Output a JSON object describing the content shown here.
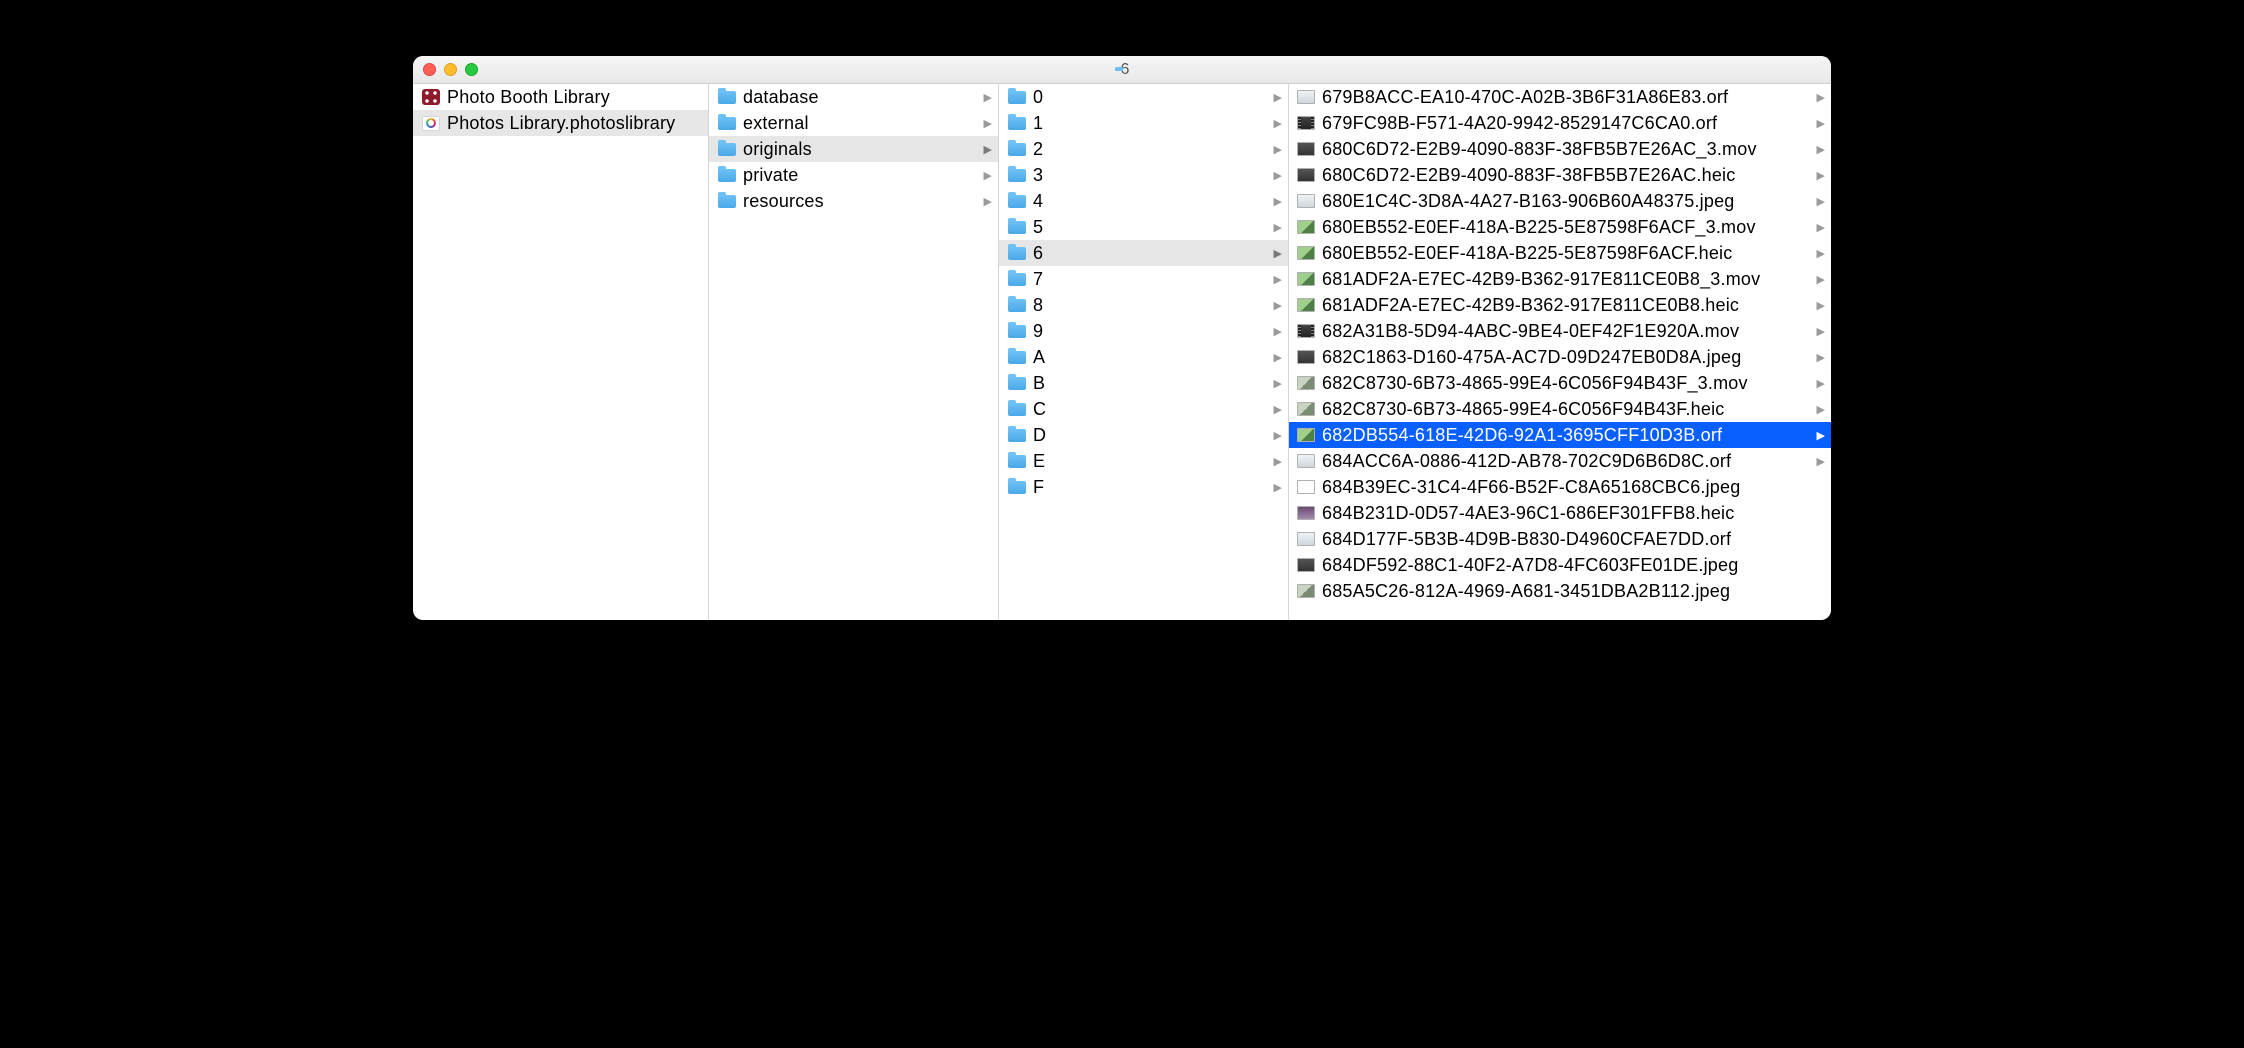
{
  "window": {
    "title": "6"
  },
  "col0": [
    {
      "label": "Photo Booth Library",
      "iconType": "pb",
      "selected": false,
      "hasChildren": false
    },
    {
      "label": "Photos Library.photoslibrary",
      "iconType": "photos",
      "selected": true,
      "hasChildren": false
    }
  ],
  "col1": [
    {
      "label": "database",
      "iconType": "folder",
      "selected": false,
      "hasChildren": true
    },
    {
      "label": "external",
      "iconType": "folder",
      "selected": false,
      "hasChildren": true
    },
    {
      "label": "originals",
      "iconType": "folder",
      "selected": true,
      "hasChildren": true
    },
    {
      "label": "private",
      "iconType": "folder",
      "selected": false,
      "hasChildren": true
    },
    {
      "label": "resources",
      "iconType": "folder",
      "selected": false,
      "hasChildren": true
    }
  ],
  "col2": [
    {
      "label": "0",
      "iconType": "folder",
      "selected": false,
      "hasChildren": true
    },
    {
      "label": "1",
      "iconType": "folder",
      "selected": false,
      "hasChildren": true
    },
    {
      "label": "2",
      "iconType": "folder",
      "selected": false,
      "hasChildren": true
    },
    {
      "label": "3",
      "iconType": "folder",
      "selected": false,
      "hasChildren": true
    },
    {
      "label": "4",
      "iconType": "folder",
      "selected": false,
      "hasChildren": true
    },
    {
      "label": "5",
      "iconType": "folder",
      "selected": false,
      "hasChildren": true
    },
    {
      "label": "6",
      "iconType": "folder",
      "selected": true,
      "hasChildren": true
    },
    {
      "label": "7",
      "iconType": "folder",
      "selected": false,
      "hasChildren": true
    },
    {
      "label": "8",
      "iconType": "folder",
      "selected": false,
      "hasChildren": true
    },
    {
      "label": "9",
      "iconType": "folder",
      "selected": false,
      "hasChildren": true
    },
    {
      "label": "A",
      "iconType": "folder",
      "selected": false,
      "hasChildren": true
    },
    {
      "label": "B",
      "iconType": "folder",
      "selected": false,
      "hasChildren": true
    },
    {
      "label": "C",
      "iconType": "folder",
      "selected": false,
      "hasChildren": true
    },
    {
      "label": "D",
      "iconType": "folder",
      "selected": false,
      "hasChildren": true
    },
    {
      "label": "E",
      "iconType": "folder",
      "selected": false,
      "hasChildren": true
    },
    {
      "label": "F",
      "iconType": "folder",
      "selected": false,
      "hasChildren": true
    }
  ],
  "col3": [
    {
      "label": "679B8ACC-EA10-470C-A02B-3B6F31A86E83.orf",
      "iconType": "thumb snow",
      "arrow": true
    },
    {
      "label": "679FC98B-F571-4A20-9942-8529147C6CA0.orf",
      "iconType": "thumb mov",
      "arrow": true
    },
    {
      "label": "680C6D72-E2B9-4090-883F-38FB5B7E26AC_3.mov",
      "iconType": "thumb dark",
      "arrow": true
    },
    {
      "label": "680C6D72-E2B9-4090-883F-38FB5B7E26AC.heic",
      "iconType": "thumb dark",
      "arrow": true
    },
    {
      "label": "680E1C4C-3D8A-4A27-B163-906B60A48375.jpeg",
      "iconType": "thumb snow",
      "arrow": true
    },
    {
      "label": "680EB552-E0EF-418A-B225-5E87598F6ACF_3.mov",
      "iconType": "thumb green",
      "arrow": true
    },
    {
      "label": "680EB552-E0EF-418A-B225-5E87598F6ACF.heic",
      "iconType": "thumb green",
      "arrow": true
    },
    {
      "label": "681ADF2A-E7EC-42B9-B362-917E811CE0B8_3.mov",
      "iconType": "thumb green",
      "arrow": true
    },
    {
      "label": "681ADF2A-E7EC-42B9-B362-917E811CE0B8.heic",
      "iconType": "thumb green",
      "arrow": true
    },
    {
      "label": "682A31B8-5D94-4ABC-9BE4-0EF42F1E920A.mov",
      "iconType": "thumb mov",
      "arrow": true
    },
    {
      "label": "682C1863-D160-475A-AC7D-09D247EB0D8A.jpeg",
      "iconType": "thumb dark",
      "arrow": true
    },
    {
      "label": "682C8730-6B73-4865-99E4-6C056F94B43F_3.mov",
      "iconType": "thumb",
      "arrow": true
    },
    {
      "label": "682C8730-6B73-4865-99E4-6C056F94B43F.heic",
      "iconType": "thumb",
      "arrow": true
    },
    {
      "label": "682DB554-618E-42D6-92A1-3695CFF10D3B.orf",
      "iconType": "thumb green",
      "arrow": true,
      "selected": true
    },
    {
      "label": "684ACC6A-0886-412D-AB78-702C9D6B6D8C.orf",
      "iconType": "thumb snow",
      "arrow": true
    },
    {
      "label": "684B39EC-31C4-4F66-B52F-C8A65168CBC6.jpeg",
      "iconType": "thumb white",
      "arrow": false
    },
    {
      "label": "684B231D-0D57-4AE3-96C1-686EF301FFB8.heic",
      "iconType": "thumb purple",
      "arrow": false
    },
    {
      "label": "684D177F-5B3B-4D9B-B830-D4960CFAE7DD.orf",
      "iconType": "thumb snow",
      "arrow": false
    },
    {
      "label": "684DF592-88C1-40F2-A7D8-4FC603FE01DE.jpeg",
      "iconType": "thumb dark",
      "arrow": false
    },
    {
      "label": "685A5C26-812A-4969-A681-3451DBA2B112.jpeg",
      "iconType": "thumb",
      "arrow": false
    }
  ]
}
